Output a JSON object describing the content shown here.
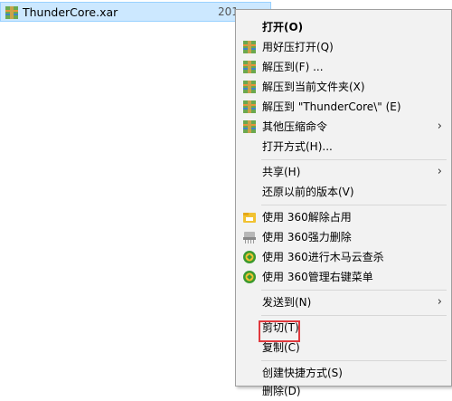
{
  "file": {
    "name": "ThunderCore.xar",
    "date": "201"
  },
  "menu": {
    "open": "打开(O)",
    "open_haozip": "用好压打开(Q)",
    "extract_to": "解压到(F) ...",
    "extract_here": "解压到当前文件夹(X)",
    "extract_named": "解压到 \"ThunderCore\\\" (E)",
    "other_compress": "其他压缩命令",
    "open_with": "打开方式(H)...",
    "share": "共享(H)",
    "restore": "还原以前的版本(V)",
    "unlock_360": "使用 360解除占用",
    "force_delete_360": "使用 360强力删除",
    "trojan_scan_360": "使用 360进行木马云查杀",
    "manage_menu_360": "使用 360管理右键菜单",
    "send_to": "发送到(N)",
    "cut": "剪切(T)",
    "copy": "复制(C)",
    "create_shortcut": "创建快捷方式(S)",
    "delete": "删除(D)"
  },
  "colors": {
    "selection": "#cce8ff",
    "highlight_box": "#e0393e",
    "menu_bg": "#f2f2f2"
  },
  "icons": {
    "archive": "haozip-archive-icon",
    "unlock": "360-unlock-icon",
    "shred": "360-shred-icon",
    "green": "360-guard-icon",
    "submenu": "chevron-right-icon"
  }
}
